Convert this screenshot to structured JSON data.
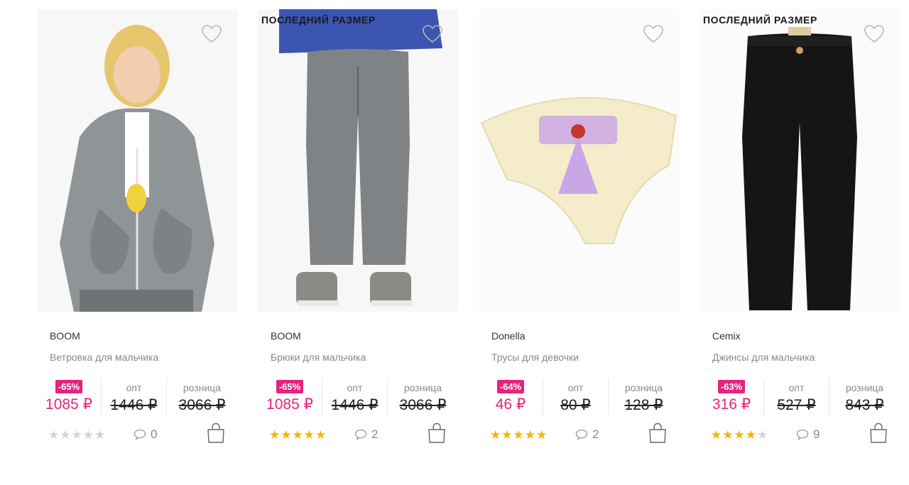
{
  "currency": "₽",
  "labels": {
    "opt": "опт",
    "retail": "розница"
  },
  "products": [
    {
      "brand": "BOOM",
      "title": "Ветровка для мальчика",
      "discount": "-65%",
      "price": "1085 ₽",
      "opt": "1446 ₽",
      "retail": "3066 ₽",
      "rating": 0,
      "comments": "0",
      "last_size": "",
      "image": "boy-jacket-photo"
    },
    {
      "brand": "BOOM",
      "title": "Брюки для мальчика",
      "discount": "-65%",
      "price": "1085 ₽",
      "opt": "1446 ₽",
      "retail": "3066 ₽",
      "rating": 5,
      "comments": "2",
      "last_size": "ПОСЛЕДНИЙ РАЗМЕР",
      "image": "boy-pants-photo"
    },
    {
      "brand": "Donella",
      "title": "Трусы для девочки",
      "discount": "-64%",
      "price": "46 ₽",
      "opt": "80 ₽",
      "retail": "128 ₽",
      "rating": 5,
      "comments": "2",
      "last_size": "",
      "image": "girl-briefs-photo"
    },
    {
      "brand": "Cemix",
      "title": "Джинсы для мальчика",
      "discount": "-63%",
      "price": "316 ₽",
      "opt": "527 ₽",
      "retail": "843 ₽",
      "rating": 4,
      "comments": "9",
      "last_size": "ПОСЛЕДНИЙ РАЗМЕР",
      "image": "black-jeans-photo"
    }
  ],
  "colors": {
    "accent": "#e6237e",
    "star": "#f4b400",
    "star_empty": "#d2d2d2",
    "muted": "#888888"
  }
}
